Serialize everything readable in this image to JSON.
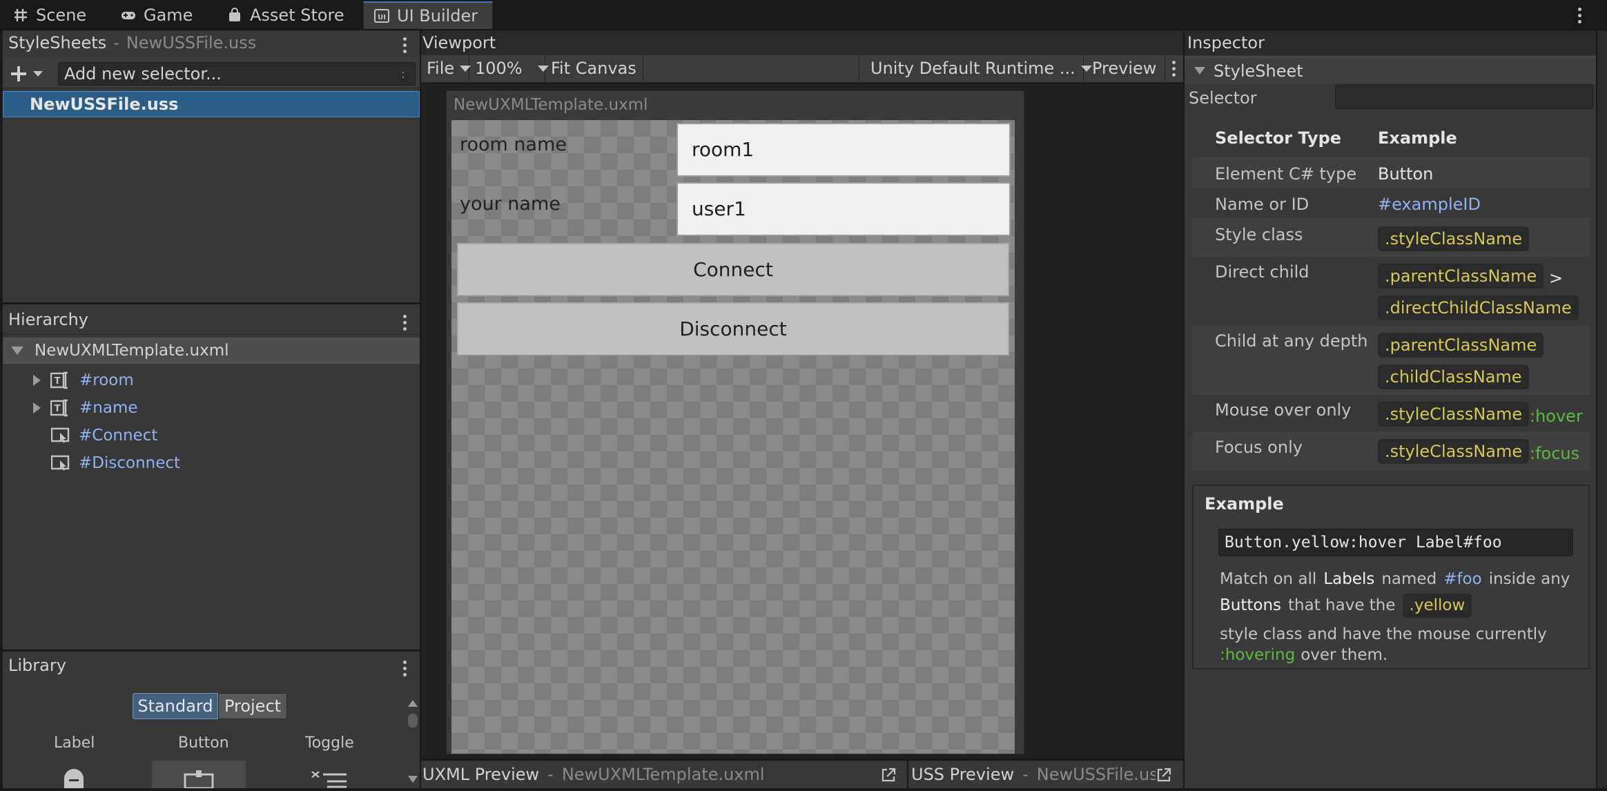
{
  "tabs": [
    {
      "label": "Scene",
      "icon": "scene-grid-icon"
    },
    {
      "label": "Game",
      "icon": "gamepad-icon"
    },
    {
      "label": "Asset Store",
      "icon": "shopping-bag-icon"
    },
    {
      "label": "UI Builder",
      "icon": "ui-builder-icon",
      "active": true
    }
  ],
  "stylesheets": {
    "title": "StyleSheets",
    "separator": "-",
    "file": "NewUSSFile.uss",
    "add_placeholder": "Add new selector...",
    "add_extra": ":",
    "selected_item": "NewUSSFile.uss"
  },
  "hierarchy": {
    "title": "Hierarchy",
    "root": "NewUXMLTemplate.uxml",
    "items": [
      "#room",
      "#name",
      "#Connect",
      "#Disconnect"
    ]
  },
  "library": {
    "title": "Library",
    "tab_standard": "Standard",
    "tab_project": "Project",
    "items": [
      "Label",
      "Button",
      "Toggle"
    ]
  },
  "viewport": {
    "title": "Viewport",
    "file_menu": "File",
    "zoom": "100%",
    "fit_canvas": "Fit Canvas",
    "theme": "Unity Default Runtime ...",
    "preview": "Preview",
    "canvas_title": "NewUXMLTemplate.uxml",
    "fields": [
      {
        "label": "room name",
        "value": "room1"
      },
      {
        "label": "your name",
        "value": "user1"
      }
    ],
    "buttons": [
      "Connect",
      "Disconnect"
    ],
    "uxml_preview": "UXML Preview",
    "uxml_preview_file": "NewUXMLTemplate.uxml",
    "uss_preview": "USS Preview",
    "uss_preview_file": "NewUSSFile.uss",
    "separator": "-"
  },
  "inspector": {
    "title": "Inspector",
    "section": "StyleSheet",
    "selector_label": "Selector",
    "header_type": "Selector Type",
    "header_example": "Example",
    "rows": {
      "element_type": {
        "label": "Element C# type",
        "example": "Button"
      },
      "name_id": {
        "label": "Name or ID",
        "example": "#exampleID"
      },
      "style_class": {
        "label": "Style class",
        "chip": ".styleClassName"
      },
      "direct_child": {
        "label": "Direct child",
        "chip1": ".parentClassName",
        "op": ">",
        "chip2": ".directChildClassName"
      },
      "child_any": {
        "label": "Child at any depth",
        "chip1": ".parentClassName",
        "chip2": ".childClassName"
      },
      "mouse_over": {
        "label": "Mouse over only",
        "chip": ".styleClassName",
        "pseudo": ":hover"
      },
      "focus_only": {
        "label": "Focus only",
        "chip": ".styleClassName",
        "pseudo": ":focus"
      }
    },
    "example_box": {
      "title": "Example",
      "code": "Button.yellow:hover Label#foo",
      "line1_pre": "Match on all",
      "line1_labels": "Labels",
      "line1_named": "named",
      "line1_id": "#foo",
      "line1_post": "inside any",
      "line2_buttons": "Buttons",
      "line2_mid": "that have the",
      "line2_chip": ".yellow",
      "line3": "style class and have the mouse currently",
      "line4_pseudo": ":hovering",
      "line4_post": "over them."
    }
  },
  "colors": {
    "accent": "#3a79bb",
    "selection": "#2c5d87",
    "link": "#8db4f0",
    "chip_text": "#d6c856",
    "pseudo": "#5cbb3e"
  }
}
